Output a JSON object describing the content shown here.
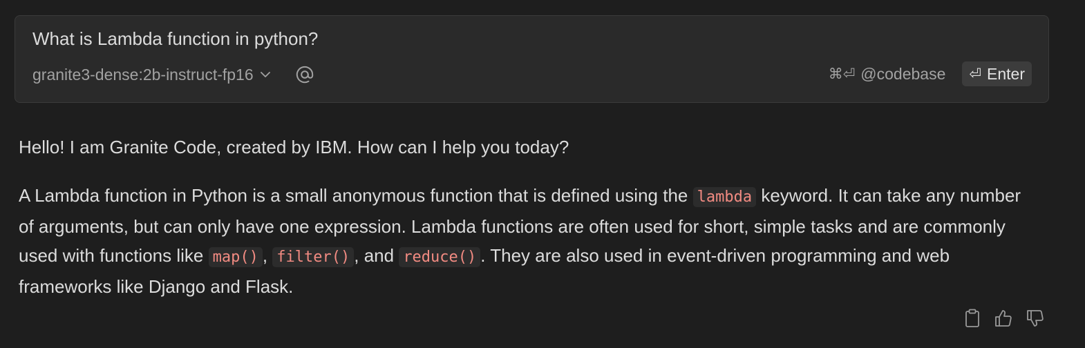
{
  "input": {
    "question": "What is Lambda function in python?",
    "model": "granite3-dense:2b-instruct-fp16",
    "codebase_shortcut": "⌘⏎",
    "codebase_label": "@codebase",
    "enter_glyph": "⏎",
    "enter_label": "Enter"
  },
  "response": {
    "greeting": "Hello! I am Granite Code, created by IBM. How can I help you today?",
    "answer_parts": [
      "A Lambda function in Python is a small anonymous function that is defined using the ",
      "lambda",
      " keyword. It can take any number of arguments, but can only have one expression. Lambda functions are often used for short, simple tasks and are commonly used with functions like ",
      "map()",
      ", ",
      "filter()",
      ", and ",
      "reduce()",
      ". They are also used in event-driven programming and web frameworks like Django and Flask."
    ]
  },
  "icons": {
    "model_dropdown": "chevron-down-icon",
    "mention": "at-sign-icon",
    "copy": "clipboard-icon",
    "thumbs_up": "thumbs-up-icon",
    "thumbs_down": "thumbs-down-icon"
  },
  "colors": {
    "background": "#1e1e1e",
    "input_background": "#2a2a2a",
    "inline_code": "#f28b82"
  }
}
